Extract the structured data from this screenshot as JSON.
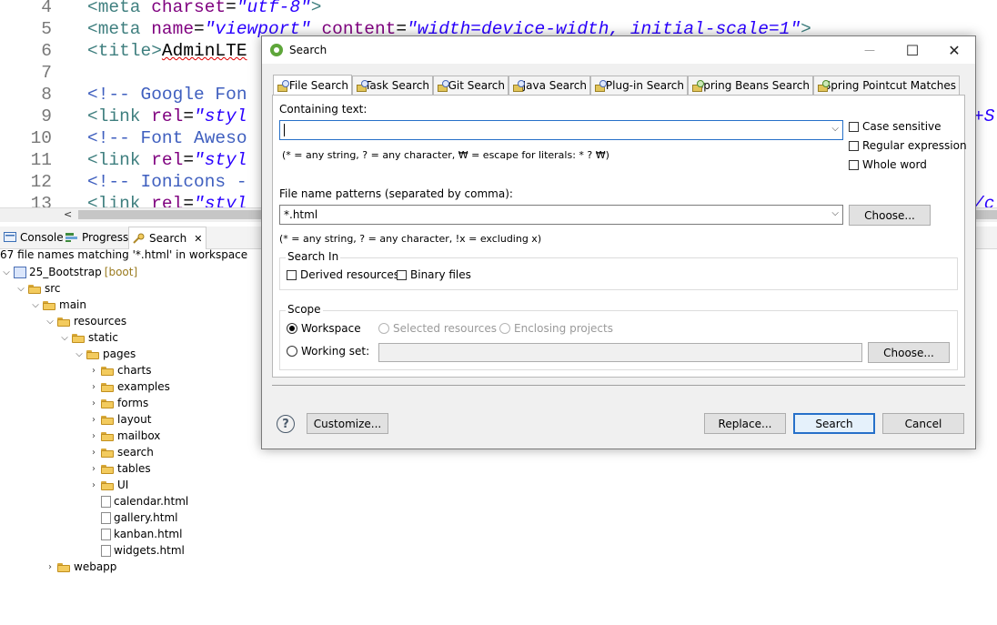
{
  "editor": {
    "lines": [
      {
        "num": "4",
        "parts": [
          [
            "tag",
            "<meta "
          ],
          [
            "attr",
            "charset"
          ],
          [
            "txt",
            "="
          ],
          [
            "val",
            "\"utf-8\""
          ],
          [
            "tag",
            ">"
          ]
        ]
      },
      {
        "num": "5",
        "parts": [
          [
            "tag",
            "<meta "
          ],
          [
            "attr",
            "name"
          ],
          [
            "txt",
            "="
          ],
          [
            "val",
            "\"viewport\""
          ],
          [
            "txt",
            " "
          ],
          [
            "attr",
            "content"
          ],
          [
            "txt",
            "="
          ],
          [
            "val",
            "\"width=device-width, initial-scale=1\""
          ],
          [
            "tag",
            ">"
          ]
        ]
      },
      {
        "num": "6",
        "parts": [
          [
            "tag",
            "<title>"
          ],
          [
            "txt",
            "AdminLTE"
          ]
        ]
      },
      {
        "num": "7",
        "parts": []
      },
      {
        "num": "8",
        "parts": [
          [
            "cmt",
            "<!-- Google Fon"
          ]
        ]
      },
      {
        "num": "9",
        "parts": [
          [
            "tag",
            "<link "
          ],
          [
            "attr",
            "rel"
          ],
          [
            "txt",
            "="
          ],
          [
            "val",
            "\"styl"
          ]
        ]
      },
      {
        "num": "10",
        "parts": [
          [
            "cmt",
            "<!-- Font Aweso"
          ]
        ]
      },
      {
        "num": "11",
        "parts": [
          [
            "tag",
            "<link "
          ],
          [
            "attr",
            "rel"
          ],
          [
            "txt",
            "="
          ],
          [
            "val",
            "\"styl"
          ]
        ]
      },
      {
        "num": "12",
        "parts": [
          [
            "cmt",
            "<!-- Ionicons -"
          ]
        ]
      },
      {
        "num": "13",
        "parts": [
          [
            "tag",
            "<link "
          ],
          [
            "attr",
            "rel"
          ],
          [
            "txt",
            "="
          ],
          [
            "val",
            "\"styl"
          ]
        ]
      }
    ],
    "right_fragments": [
      "+S",
      "/c"
    ],
    "scroll_left_arrow": "<"
  },
  "views": {
    "tabs": [
      {
        "label": "Console",
        "icon": "console-icon"
      },
      {
        "label": "Progress",
        "icon": "progress-icon"
      },
      {
        "label": "Search",
        "icon": "search-view-icon",
        "active": true
      }
    ],
    "close_glyph": "✕",
    "summary": "67 file names matching '*.html' in workspace"
  },
  "tree": [
    {
      "label": "25_Bootstrap",
      "suffix": "[boot]",
      "type": "project",
      "chev": "v",
      "indent": 0
    },
    {
      "label": "src",
      "type": "folder",
      "chev": "v",
      "indent": 1
    },
    {
      "label": "main",
      "type": "folder",
      "chev": "v",
      "indent": 2
    },
    {
      "label": "resources",
      "type": "folder",
      "chev": "v",
      "indent": 3
    },
    {
      "label": "static",
      "type": "folder",
      "chev": "v",
      "indent": 4
    },
    {
      "label": "pages",
      "type": "folder",
      "chev": "v",
      "indent": 5
    },
    {
      "label": "charts",
      "type": "folder",
      "chev": ">",
      "indent": 6
    },
    {
      "label": "examples",
      "type": "folder",
      "chev": ">",
      "indent": 6
    },
    {
      "label": "forms",
      "type": "folder",
      "chev": ">",
      "indent": 6
    },
    {
      "label": "layout",
      "type": "folder",
      "chev": ">",
      "indent": 6
    },
    {
      "label": "mailbox",
      "type": "folder",
      "chev": ">",
      "indent": 6
    },
    {
      "label": "search",
      "type": "folder",
      "chev": ">",
      "indent": 6
    },
    {
      "label": "tables",
      "type": "folder",
      "chev": ">",
      "indent": 6
    },
    {
      "label": "UI",
      "type": "folder",
      "chev": ">",
      "indent": 6
    },
    {
      "label": "calendar.html",
      "type": "file",
      "chev": "",
      "indent": 6
    },
    {
      "label": "gallery.html",
      "type": "file",
      "chev": "",
      "indent": 6
    },
    {
      "label": "kanban.html",
      "type": "file",
      "chev": "",
      "indent": 6
    },
    {
      "label": "widgets.html",
      "type": "file",
      "chev": "",
      "indent": 6
    },
    {
      "label": "webapp",
      "type": "folder",
      "chev": ">",
      "indent": 3
    }
  ],
  "dialog": {
    "title": "Search",
    "window_buttons": {
      "minimize": "—",
      "maximize": "☐",
      "close": "✕"
    },
    "tabs": [
      "File Search",
      "Task Search",
      "Git Search",
      "Java Search",
      "Plug-in Search",
      "Spring Beans Search",
      "Spring Pointcut Matches"
    ],
    "containing_text": {
      "label": "Containing text:",
      "value": "",
      "hint": "(* = any string, ? = any character, ₩ = escape for literals: * ? ₩)"
    },
    "options": {
      "case_sensitive": {
        "label": "Case sensitive",
        "checked": false
      },
      "regex": {
        "label": "Regular expression",
        "checked": false
      },
      "whole_word": {
        "label": "Whole word",
        "checked": false
      }
    },
    "file_patterns": {
      "label": "File name patterns (separated by comma):",
      "value": "*.html",
      "hint": "(* = any string, ? = any character, !x = excluding x)",
      "choose": "Choose..."
    },
    "search_in": {
      "title": "Search In",
      "derived": {
        "label": "Derived resources",
        "checked": false
      },
      "binary": {
        "label": "Binary files",
        "checked": false
      }
    },
    "scope": {
      "title": "Scope",
      "workspace": "Workspace",
      "selected": "Selected resources",
      "enclosing": "Enclosing projects",
      "working_set": "Working set:",
      "working_set_value": "",
      "choose": "Choose..."
    },
    "buttons": {
      "help": "?",
      "customize": "Customize...",
      "replace": "Replace...",
      "search": "Search",
      "cancel": "Cancel"
    }
  }
}
